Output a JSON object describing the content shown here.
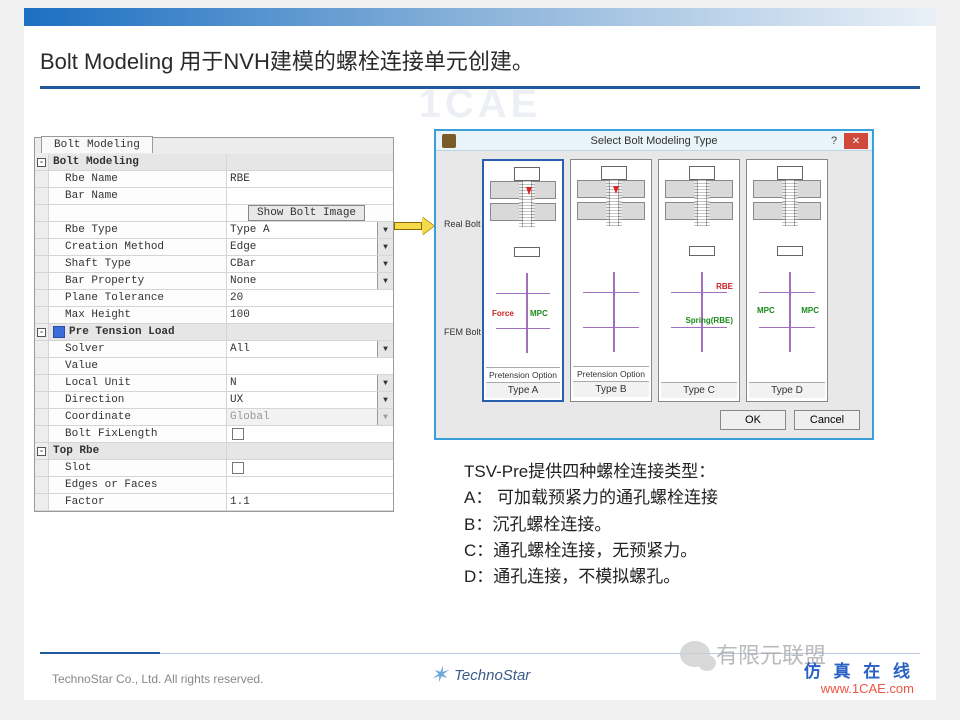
{
  "slide": {
    "title": "Bolt Modeling 用于NVH建模的螺栓连接单元创建。",
    "footer": "TechnoStar Co., Ltd. All rights reserved.",
    "brand": "TechnoStar"
  },
  "panel": {
    "tab": "Bolt Modeling",
    "sec1": "Bolt Modeling",
    "rows1": [
      {
        "label": "Rbe Name",
        "value": "RBE",
        "type": "text"
      },
      {
        "label": "Bar Name",
        "value": "",
        "type": "text"
      },
      {
        "label": "",
        "value": "Show Bolt Image",
        "type": "button"
      },
      {
        "label": "Rbe Type",
        "value": "Type A",
        "type": "dd"
      },
      {
        "label": "Creation Method",
        "value": "Edge",
        "type": "dd"
      },
      {
        "label": "Shaft Type",
        "value": "CBar",
        "type": "dd"
      },
      {
        "label": "Bar Property",
        "value": "None",
        "type": "dd"
      },
      {
        "label": "Plane Tolerance",
        "value": "20",
        "type": "text"
      },
      {
        "label": "Max Height",
        "value": "100",
        "type": "text"
      }
    ],
    "sec2": "Pre Tension Load",
    "rows2": [
      {
        "label": "Solver",
        "value": "All",
        "type": "dd"
      },
      {
        "label": "Value",
        "value": "",
        "type": "text"
      },
      {
        "label": "Local Unit",
        "value": "N",
        "type": "dd"
      },
      {
        "label": "Direction",
        "value": "UX",
        "type": "dd"
      },
      {
        "label": "Coordinate",
        "value": "Global",
        "type": "dd-dis"
      },
      {
        "label": "Bolt FixLength",
        "value": "",
        "type": "chk"
      }
    ],
    "sec3": "Top Rbe",
    "rows3": [
      {
        "label": "Slot",
        "value": "",
        "type": "chk"
      },
      {
        "label": "Edges or Faces",
        "value": "",
        "type": "text"
      },
      {
        "label": "Factor",
        "value": "1.1",
        "type": "text"
      }
    ]
  },
  "dialog": {
    "title": "Select Bolt Modeling Type",
    "side_real": "Real Bolt",
    "side_fem": "FEM Bolt",
    "pretension": "Pretension Option",
    "types": [
      "Type A",
      "Type B",
      "Type C",
      "Type D"
    ],
    "tags": {
      "force": "Force",
      "mpc": "MPC",
      "rbe": "RBE",
      "spring": "Spring(RBE)"
    },
    "ok": "OK",
    "cancel": "Cancel"
  },
  "desc": {
    "line0": "TSV-Pre提供四种螺栓连接类型：",
    "line1": "A： 可加载预紧力的通孔螺栓连接",
    "line2": "B：沉孔螺栓连接。",
    "line3": "C：通孔螺栓连接，无预紧力。",
    "line4": "D：通孔连接，不模拟螺孔。"
  },
  "watermarks": {
    "center": "1CAE",
    "wechat": "有限元联盟",
    "cn1": "仿 真 在 线",
    "cn2": "www.1CAE.com"
  }
}
